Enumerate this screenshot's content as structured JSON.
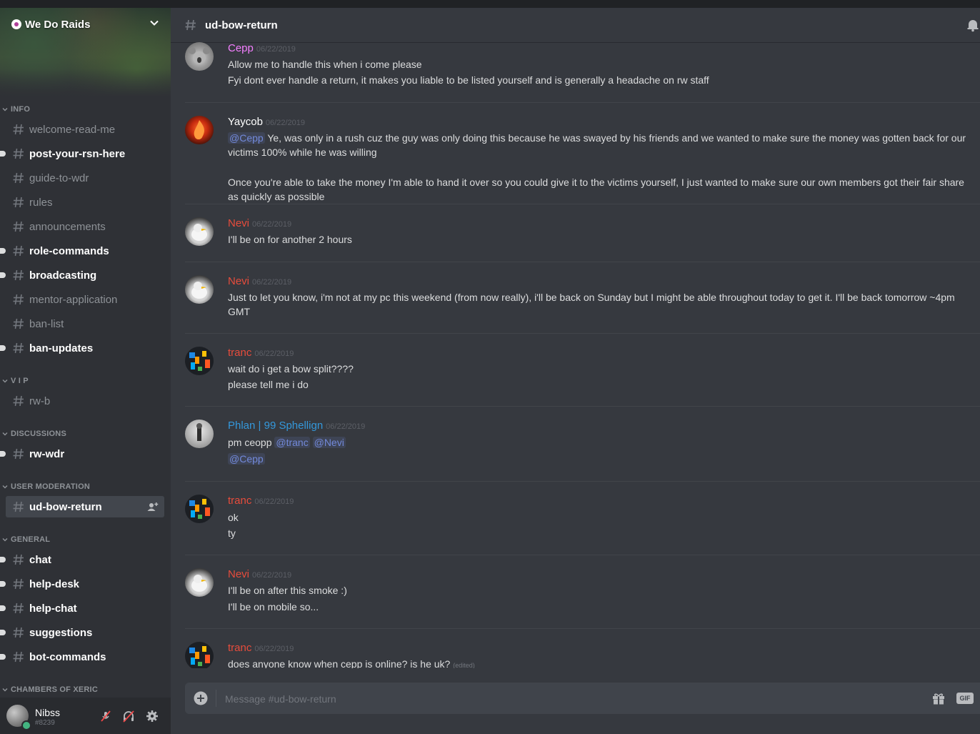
{
  "server": {
    "name": "We Do Raids"
  },
  "channel_header": {
    "title": "ud-bow-return"
  },
  "categories": [
    {
      "label": "INFO",
      "channels": [
        {
          "name": "welcome-read-me",
          "unread": false
        },
        {
          "name": "post-your-rsn-here",
          "unread": true
        },
        {
          "name": "guide-to-wdr",
          "unread": false
        },
        {
          "name": "rules",
          "unread": false
        },
        {
          "name": "announcements",
          "unread": false
        },
        {
          "name": "role-commands",
          "unread": true
        },
        {
          "name": "broadcasting",
          "unread": true
        },
        {
          "name": "mentor-application",
          "unread": false
        },
        {
          "name": "ban-list",
          "unread": false
        },
        {
          "name": "ban-updates",
          "unread": true
        }
      ]
    },
    {
      "label": "V I P",
      "channels": [
        {
          "name": "rw-b",
          "unread": false
        }
      ]
    },
    {
      "label": "DISCUSSIONS",
      "channels": [
        {
          "name": "rw-wdr",
          "unread": true
        }
      ]
    },
    {
      "label": "USER MODERATION",
      "channels": [
        {
          "name": "ud-bow-return",
          "unread": false,
          "selected": true
        }
      ]
    },
    {
      "label": "GENERAL",
      "channels": [
        {
          "name": "chat",
          "unread": true
        },
        {
          "name": "help-desk",
          "unread": true
        },
        {
          "name": "help-chat",
          "unread": true
        },
        {
          "name": "suggestions",
          "unread": true
        },
        {
          "name": "bot-commands",
          "unread": true
        }
      ]
    },
    {
      "label": "CHAMBERS OF XERIC",
      "channels": []
    }
  ],
  "user": {
    "name": "Nibss",
    "tag": "#8239",
    "status": "online"
  },
  "messages": [
    {
      "author": "Cepp",
      "color": "#f47fff",
      "time": "06/22/2019",
      "avatar": "koala",
      "lines": [
        [
          {
            "t": "Allow me to handle this when i come please"
          }
        ],
        [
          {
            "t": "Fyi dont ever handle a return, it makes you liable to be listed yourself and is generally a headache on rw staff"
          }
        ]
      ]
    },
    {
      "author": "Yaycob",
      "color": "#ffffff",
      "time": "06/22/2019",
      "avatar": "fire",
      "lines": [
        [
          {
            "m": "@Cepp"
          },
          {
            "t": " Ye, was only in a rush cuz the guy was only doing this because he was swayed by his friends and we wanted to make sure the money was gotten back for our victims 100% while he was willing"
          }
        ],
        [
          {
            "t": "Once you're able to take the money I'm able to hand it over so you could give it to the victims yourself, I just wanted to make sure our own members got their fair share as quickly as possible"
          }
        ]
      ]
    },
    {
      "author": "Nevi",
      "color": "#e74c3c",
      "time": "06/22/2019",
      "avatar": "bird",
      "lines": [
        [
          {
            "t": "I'll be on for another 2 hours"
          }
        ]
      ]
    },
    {
      "author": "Nevi",
      "color": "#e74c3c",
      "time": "06/22/2019",
      "avatar": "bird",
      "lines": [
        [
          {
            "t": "Just to let you know, i'm not at my pc this weekend (from now really), i'll be back on Sunday but I might be able throughout today to get it. I'll be back tomorrow ~4pm GMT"
          }
        ]
      ]
    },
    {
      "author": "tranc",
      "color": "#e74c3c",
      "time": "06/22/2019",
      "avatar": "pixel",
      "lines": [
        [
          {
            "t": "wait do i get a bow split????"
          }
        ],
        [
          {
            "t": "please tell me i do"
          }
        ]
      ]
    },
    {
      "author": "Phlan | 99 Sphellign",
      "color": "#3498db",
      "time": "06/22/2019",
      "avatar": "phlan",
      "lines": [
        [
          {
            "t": "pm ceopp "
          },
          {
            "m": "@tranc"
          },
          {
            "t": " "
          },
          {
            "m": "@Nevi"
          }
        ],
        [
          {
            "m": "@Cepp"
          }
        ]
      ]
    },
    {
      "author": "tranc",
      "color": "#e74c3c",
      "time": "06/22/2019",
      "avatar": "pixel",
      "lines": [
        [
          {
            "t": "ok"
          }
        ],
        [
          {
            "t": "ty"
          }
        ]
      ]
    },
    {
      "author": "Nevi",
      "color": "#e74c3c",
      "time": "06/22/2019",
      "avatar": "bird",
      "lines": [
        [
          {
            "t": "I'll be on after this smoke :)"
          }
        ],
        [
          {
            "t": "I'll be on mobile so..."
          }
        ]
      ]
    },
    {
      "author": "tranc",
      "color": "#e74c3c",
      "time": "06/22/2019",
      "avatar": "pixel",
      "lines": [
        [
          {
            "t": "does anyone know when cepp is online? is he uk? "
          },
          {
            "e": "(edited)"
          }
        ]
      ]
    }
  ],
  "composer": {
    "placeholder": "Message #ud-bow-return",
    "value": "",
    "gif_label": "GIF"
  },
  "icons": {
    "hash": "hash-icon",
    "chevron": "chevron-down-icon",
    "invite": "add-member-icon",
    "bell": "bell-icon",
    "mic": "mic-muted-icon",
    "headset": "headset-deafened-icon",
    "settings": "gear-icon",
    "plus": "plus-circle-icon",
    "gift": "gift-icon"
  },
  "colors": {
    "sidebar": "#2f3136",
    "main": "#36393f",
    "mention": "#7289da",
    "online": "#43b581"
  }
}
